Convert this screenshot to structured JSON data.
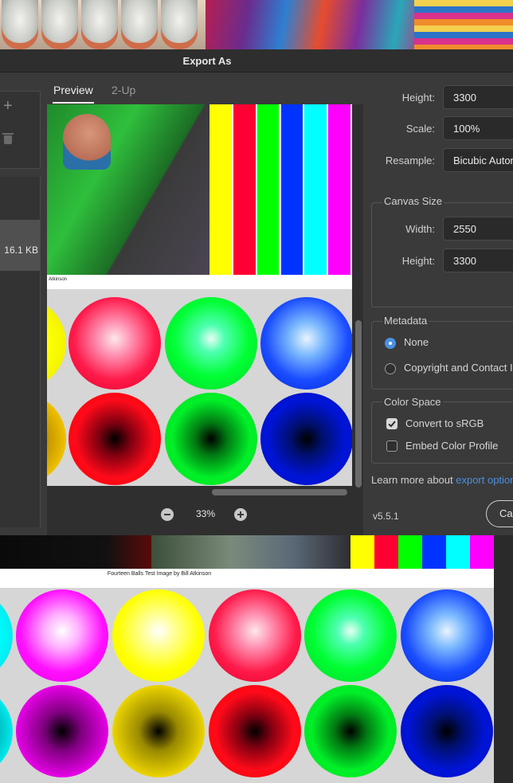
{
  "dialog": {
    "title": "Export As"
  },
  "tabs": [
    {
      "label": "Preview"
    },
    {
      "label": "2-Up"
    }
  ],
  "asset": {
    "file_size": "16.1 KB"
  },
  "zoom": {
    "level": "33%"
  },
  "image_size": {
    "height_label": "Height:",
    "height_value": "3300",
    "scale_label": "Scale:",
    "scale_value": "100%",
    "resample_label": "Resample:",
    "resample_value": "Bicubic Automatic"
  },
  "canvas_size": {
    "title": "Canvas Size",
    "width_label": "Width:",
    "width_value": "2550",
    "height_label": "Height:",
    "height_value": "3300"
  },
  "metadata": {
    "title": "Metadata",
    "options": [
      {
        "label": "None",
        "selected": true
      },
      {
        "label": "Copyright and Contact Info",
        "selected": false
      }
    ]
  },
  "color_space": {
    "title": "Color Space",
    "options": [
      {
        "label": "Convert to sRGB",
        "checked": true
      },
      {
        "label": "Embed Color Profile",
        "checked": false
      }
    ]
  },
  "footer": {
    "learn_more_text": "Learn more about ",
    "learn_more_link": "export options",
    "version": "v5.5.1",
    "cancel_label": "Cancel"
  },
  "preview_caption": "Atkinson",
  "background_doc": {
    "caption": "Fourteen Balls Test Image by Bill Atkinson"
  },
  "colors": {
    "accent": "#4a90e2",
    "dialog_bg": "#3a3a3a",
    "bars": [
      "#ffff00",
      "#ff0033",
      "#00ff00",
      "#0033ff",
      "#00ffff",
      "#ff00ff"
    ]
  }
}
